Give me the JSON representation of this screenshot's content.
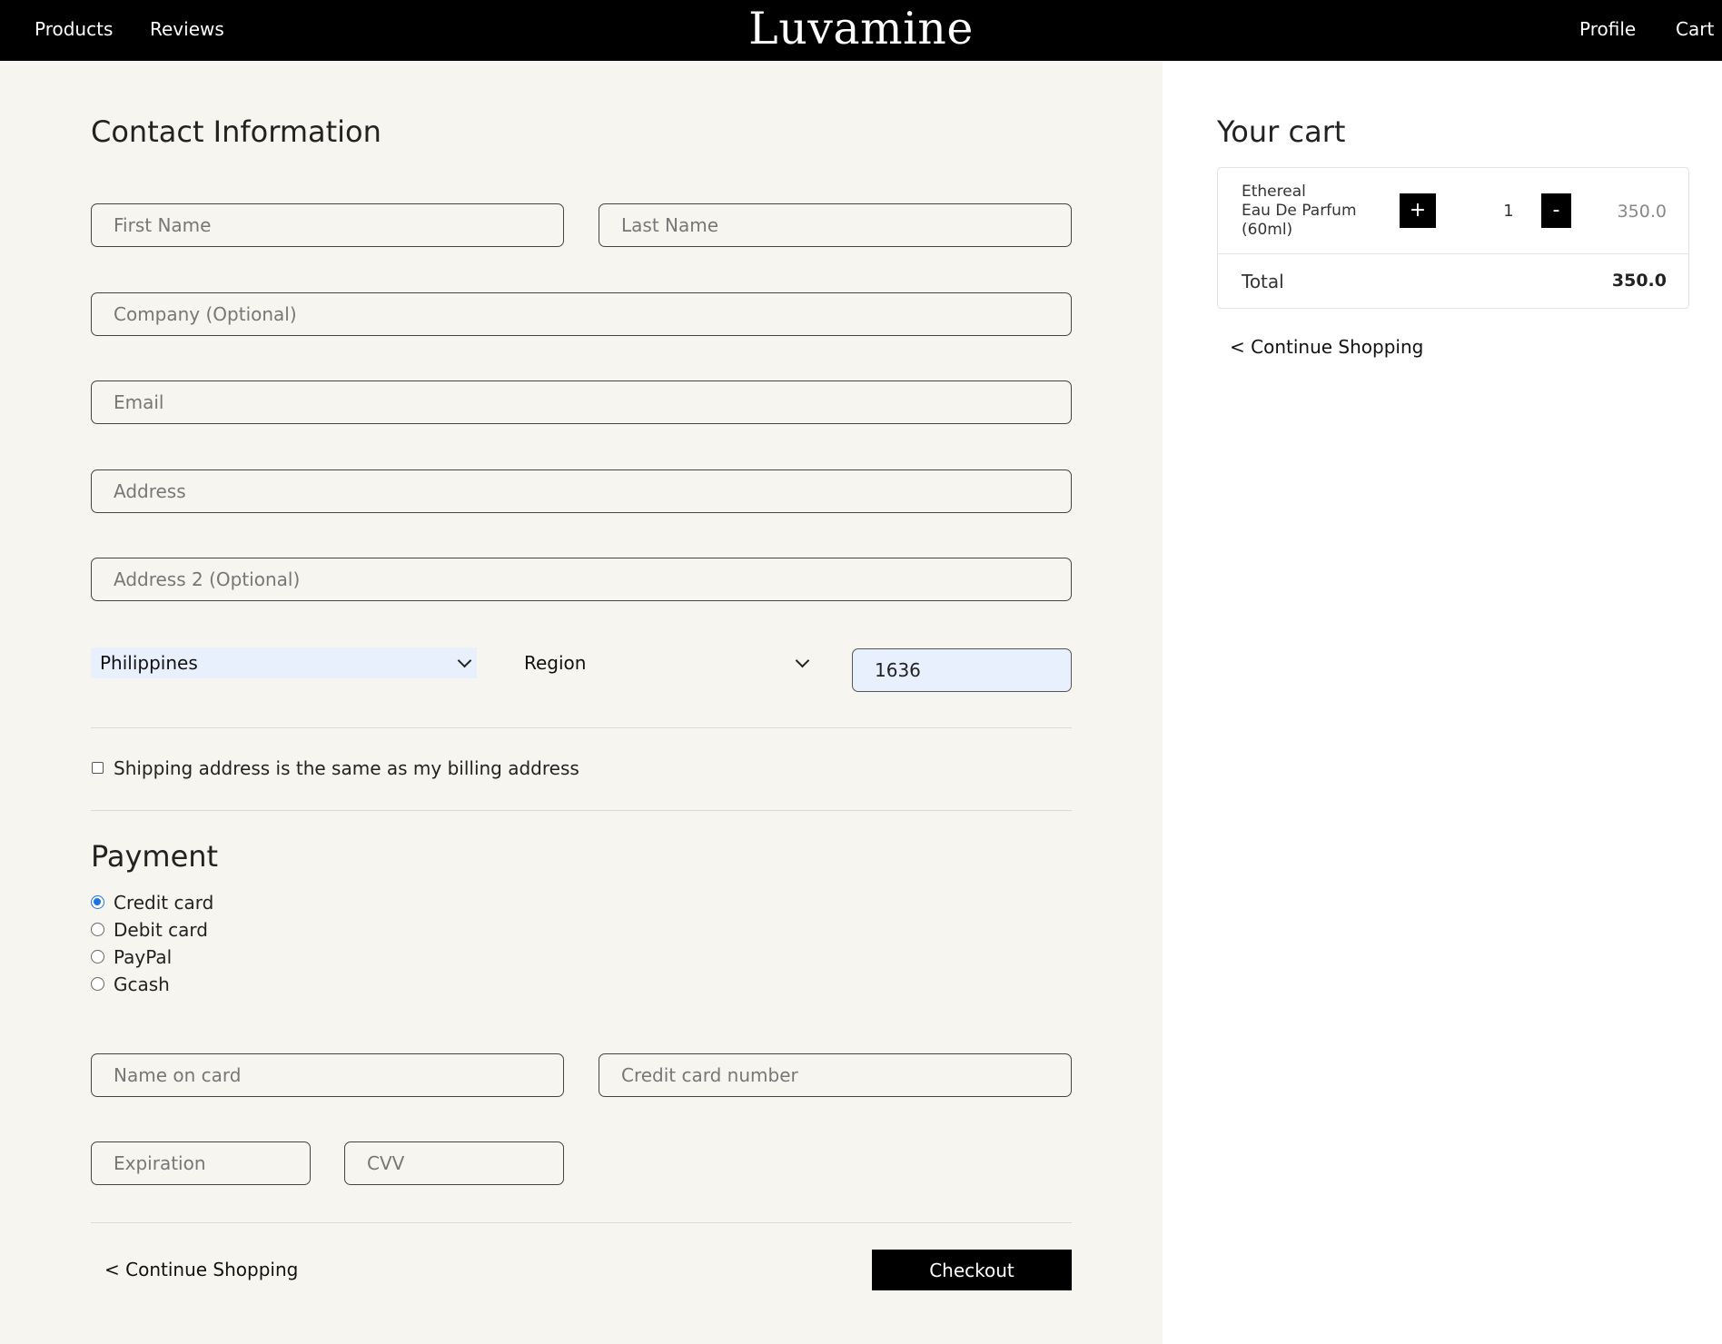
{
  "nav": {
    "brand": "Luvamine",
    "left_links": [
      "Products",
      "Reviews"
    ],
    "right_links": [
      "Profile",
      "Cart"
    ]
  },
  "contact": {
    "title": "Contact Information",
    "first_name_placeholder": "First Name",
    "last_name_placeholder": "Last Name",
    "company_placeholder": "Company (Optional)",
    "email_placeholder": "Email",
    "address_placeholder": "Address",
    "address2_placeholder": "Address 2 (Optional)",
    "country_value": "Philippines",
    "region_value": "Region",
    "postal_value": "1636",
    "same_address_label": "Shipping address is the same as my billing address",
    "same_address_checked": false
  },
  "payment": {
    "title": "Payment",
    "options": [
      "Credit card",
      "Debit card",
      "PayPal",
      "Gcash"
    ],
    "selected": "Credit card",
    "name_on_card_placeholder": "Name on card",
    "card_number_placeholder": "Credit card number",
    "expiration_placeholder": "Expiration",
    "cvv_placeholder": "CVV"
  },
  "actions": {
    "continue_shopping": "< Continue Shopping",
    "checkout": "Checkout"
  },
  "cart": {
    "title": "Your cart",
    "items": [
      {
        "name_lines": [
          "Ethereal",
          "Eau De Parfum",
          "(60ml)"
        ],
        "plus_label": "+",
        "quantity": "1",
        "minus_label": "-",
        "price": "350.0"
      }
    ],
    "total_label": "Total",
    "total_value": "350.0",
    "continue_shopping": "< Continue Shopping"
  },
  "colors": {
    "nav_bg": "#000000",
    "form_bg": "#f6f5ef",
    "autofill_bg": "#e8f0fe",
    "radio_accent": "#1a73e8"
  }
}
